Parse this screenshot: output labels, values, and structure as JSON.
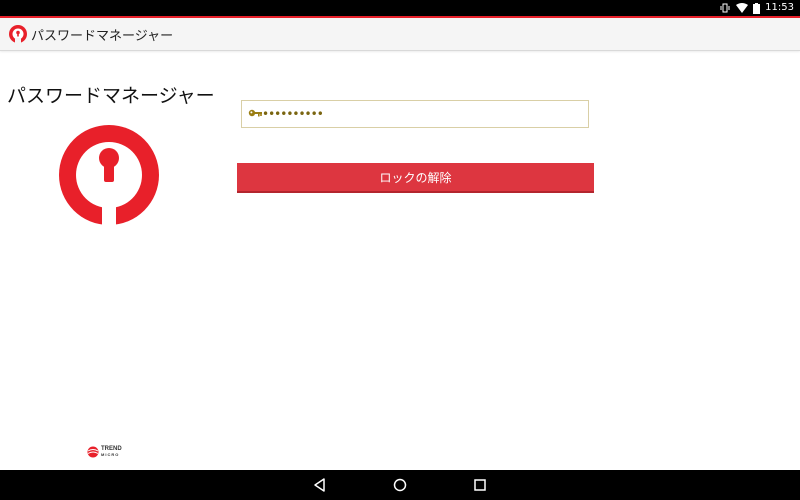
{
  "status_bar": {
    "time": "11:53"
  },
  "app_bar": {
    "title": "パスワードマネージャー"
  },
  "main": {
    "title": "パスワードマネージャー",
    "password_value": "••••••••••",
    "unlock_button": "ロックの解除"
  },
  "brand": {
    "line1": "TREND",
    "line2": "MICRO"
  },
  "colors": {
    "accent": "#e8202a",
    "button": "#dd3640",
    "field_border": "#d9cfa6",
    "key": "#9a7d12"
  },
  "icons": {
    "status": [
      "vibrate-icon",
      "wifi-icon",
      "battery-icon"
    ],
    "app": "password-manager-logo-icon",
    "field": "key-icon",
    "nav": [
      "back-icon",
      "home-icon",
      "recents-icon"
    ]
  }
}
